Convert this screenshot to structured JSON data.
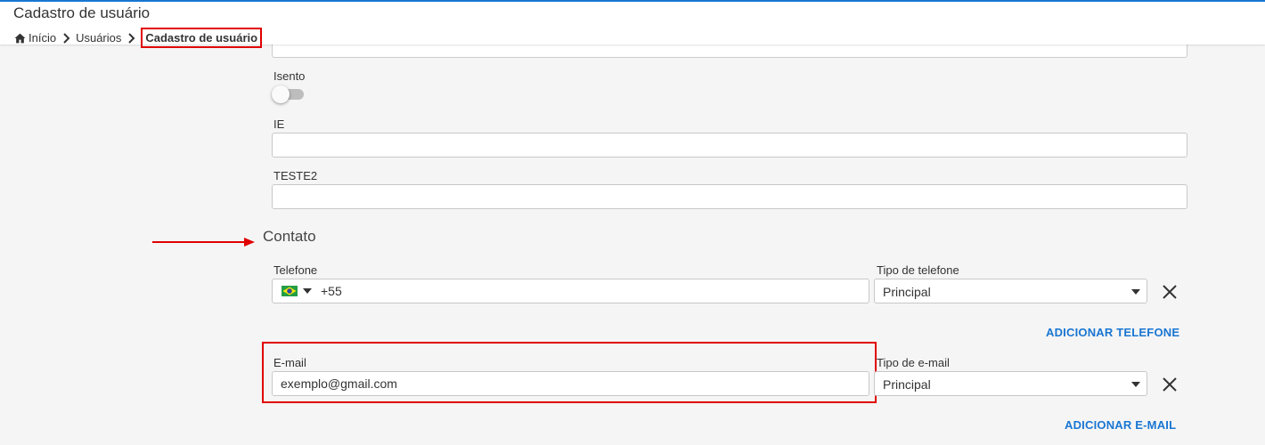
{
  "header": {
    "title": "Cadastro de usuário",
    "breadcrumb": [
      "Início",
      "Usuários",
      "Cadastro de usuário"
    ]
  },
  "form": {
    "isento_label": "Isento",
    "isento_value": false,
    "ie_label": "IE",
    "ie_value": "",
    "teste2_label": "TESTE2",
    "teste2_value": "",
    "contact_section_title": "Contato",
    "phone": {
      "label": "Telefone",
      "country_code": "+55",
      "type_label": "Tipo de telefone",
      "type_value": "Principal",
      "add_label": "ADICIONAR TELEFONE"
    },
    "email": {
      "label": "E-mail",
      "value": "exemplo@gmail.com",
      "type_label": "Tipo de e-mail",
      "type_value": "Principal",
      "add_label": "ADICIONAR E-MAIL"
    }
  },
  "colors": {
    "accent": "#1976d2",
    "annotation": "#e00000"
  }
}
